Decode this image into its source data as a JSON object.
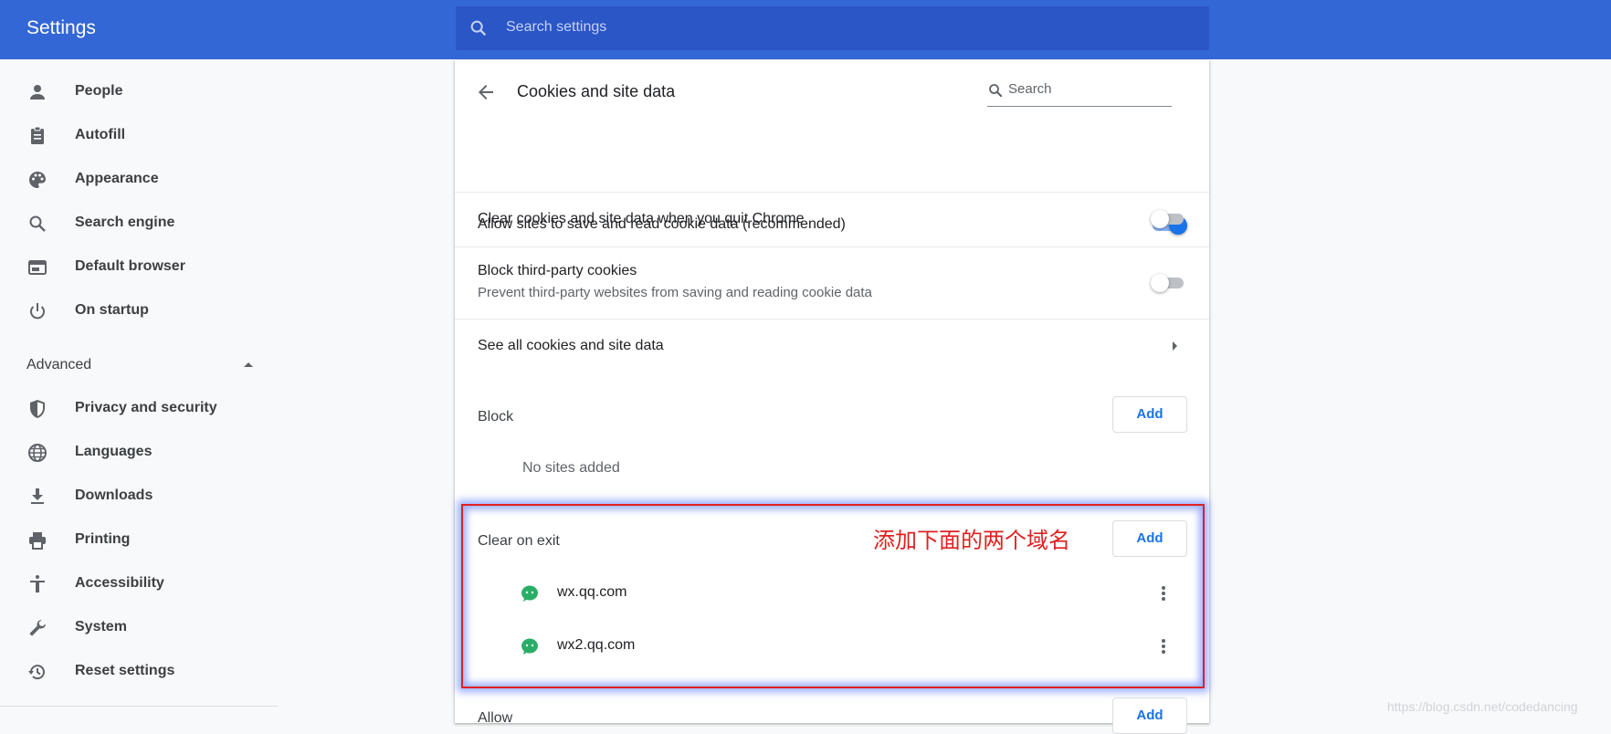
{
  "app": {
    "title": "Settings"
  },
  "search": {
    "placeholder": "Search settings"
  },
  "sidebar": {
    "items": [
      {
        "label": "People",
        "icon": "person-icon"
      },
      {
        "label": "Autofill",
        "icon": "clipboard-icon"
      },
      {
        "label": "Appearance",
        "icon": "palette-icon"
      },
      {
        "label": "Search engine",
        "icon": "search-icon"
      },
      {
        "label": "Default browser",
        "icon": "browser-window-icon"
      },
      {
        "label": "On startup",
        "icon": "power-icon"
      }
    ],
    "advanced_label": "Advanced",
    "advanced_items": [
      {
        "label": "Privacy and security",
        "icon": "shield-icon"
      },
      {
        "label": "Languages",
        "icon": "globe-icon"
      },
      {
        "label": "Downloads",
        "icon": "download-icon"
      },
      {
        "label": "Printing",
        "icon": "printer-icon"
      },
      {
        "label": "Accessibility",
        "icon": "accessibility-icon"
      },
      {
        "label": "System",
        "icon": "wrench-icon"
      },
      {
        "label": "Reset settings",
        "icon": "restore-icon"
      }
    ]
  },
  "page": {
    "title": "Cookies and site data",
    "search_placeholder": "Search",
    "settings": [
      {
        "label": "Allow sites to save and read cookie data (recommended)",
        "enabled": true
      },
      {
        "label": "Clear cookies and site data when you quit Chrome",
        "enabled": false
      },
      {
        "label": "Block third-party cookies",
        "secondary": "Prevent third-party websites from saving and reading cookie data",
        "enabled": false
      }
    ],
    "see_all_label": "See all cookies and site data",
    "block": {
      "title": "Block",
      "add_label": "Add",
      "empty_text": "No sites added"
    },
    "clear_on_exit": {
      "title": "Clear on exit",
      "add_label": "Add",
      "sites": [
        "wx.qq.com",
        "wx2.qq.com"
      ]
    },
    "allow": {
      "title": "Allow",
      "add_label": "Add"
    }
  },
  "annotation": {
    "text": "添加下面的两个域名",
    "color": "#e02020"
  },
  "watermark": "https://blog.csdn.net/codedancing",
  "colors": {
    "header": "#3367d6",
    "search_bg": "#2a56c6",
    "accent": "#1a73e8",
    "site_icon": "#2aae67"
  }
}
